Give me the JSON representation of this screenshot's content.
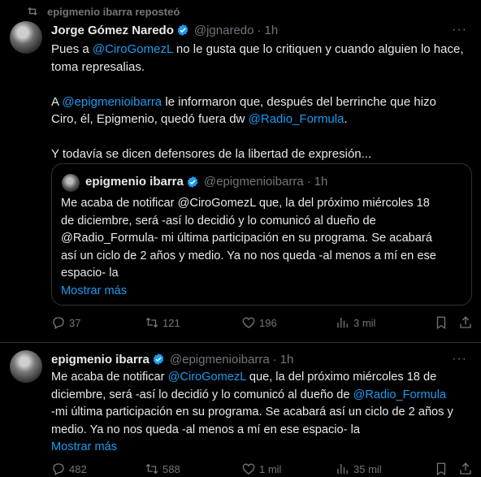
{
  "repost": {
    "text": "epigmenio ibarra reposteó"
  },
  "tweet1": {
    "name": "Jorge Gómez Naredo",
    "handle": "@jgnaredo",
    "sep": "·",
    "time": "1h",
    "p1_a": "Pues a ",
    "p1_link": "@CiroGomezL",
    "p1_b": " no le gusta que lo critiquen y cuando alguien lo hace,",
    "p1_c": "toma represalias.",
    "p2_a": "A ",
    "p2_link1": "@epigmenioibarra",
    "p2_b": " le informaron que, después del berrinche que hizo",
    "p2_c": "Ciro, él, Epigmenio, quedó fuera dw ",
    "p2_link2": "@Radio_Formula",
    "p2_d": ".",
    "p3": "Y todavía se dicen defensores de la libertad de expresión...",
    "quote": {
      "name": "epigmenio ibarra",
      "handle": "@epigmenioibarra",
      "sep": "·",
      "time": "1h",
      "lines": [
        "Me acaba de notificar @CiroGomezL que, la del próximo miércoles 18",
        "de diciembre, será -así lo decidió y lo comunicó al dueño de",
        "@Radio_Formula- mi última participación en su programa. Se acabará",
        "así un ciclo de 2 años y medio. Ya no nos queda -al menos a mí en ese",
        "espacio- la"
      ],
      "more": "Mostrar más"
    },
    "actions": {
      "replies": "37",
      "reposts": "121",
      "likes": "196",
      "views": "3 mil"
    }
  },
  "tweet2": {
    "name": "epigmenio ibarra",
    "handle": "@epigmenioibarra",
    "sep": "·",
    "time": "1h",
    "l1_a": "Me acaba de notificar ",
    "l1_link": "@CiroGomezL",
    "l1_b": " que, la del próximo miércoles 18 de",
    "l2_a": "diciembre, será -así lo decidió y lo comunicó al dueño de ",
    "l2_link": "@Radio_Formula",
    "l3": "-mi última participación en su programa. Se acabará así un ciclo de 2 años y",
    "l4": "medio. Ya no nos queda -al menos a mí en ese espacio- la",
    "more": "Mostrar más",
    "actions": {
      "replies": "482",
      "reposts": "588",
      "likes": "1 mil",
      "views": "35 mil"
    }
  },
  "colors": {
    "background": "#000000",
    "text": "#e7e9ea",
    "muted": "#71767b",
    "link": "#1d9bf0",
    "divider": "#2f3336",
    "repost_green": "#00ba7c"
  },
  "icons": [
    "repost-icon",
    "verified-badge-icon",
    "more-options-icon",
    "reply-icon",
    "retweet-icon",
    "like-icon",
    "views-icon",
    "bookmark-icon",
    "share-icon"
  ]
}
